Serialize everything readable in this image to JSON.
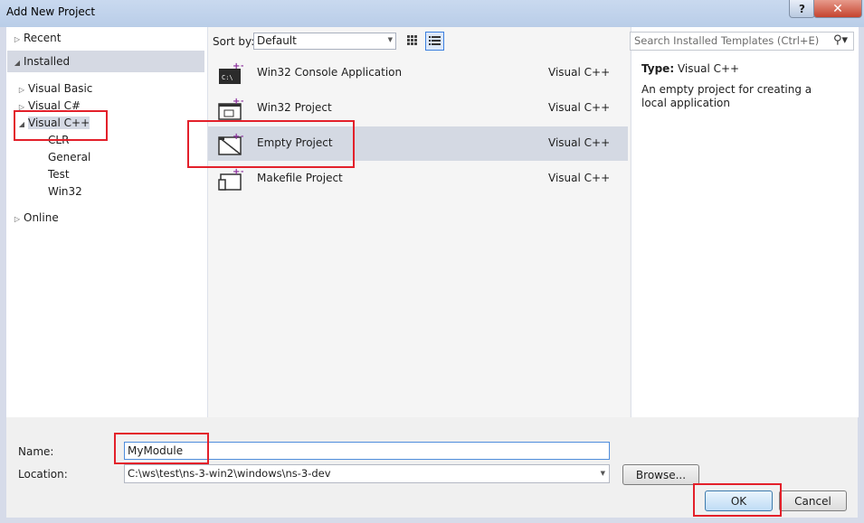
{
  "window": {
    "title": "Add New Project",
    "help_label": "?",
    "close_label": "✕"
  },
  "left_nav": {
    "recent": "Recent",
    "installed": "Installed",
    "visual_basic": "Visual Basic",
    "visual_csharp": "Visual C#",
    "visual_cpp": "Visual C++",
    "sub_items": [
      "CLR",
      "General",
      "Test",
      "Win32"
    ],
    "online": "Online"
  },
  "toolbar": {
    "sort_label": "Sort by:",
    "sort_value": "Default"
  },
  "search": {
    "placeholder": "Search Installed Templates (Ctrl+E)"
  },
  "templates": [
    {
      "name": "Win32 Console Application",
      "language": "Visual C++"
    },
    {
      "name": "Win32 Project",
      "language": "Visual C++"
    },
    {
      "name": "Empty Project",
      "language": "Visual C++",
      "selected": true
    },
    {
      "name": "Makefile Project",
      "language": "Visual C++"
    }
  ],
  "details": {
    "type_label": "Type:",
    "type_value": "Visual C++",
    "description": "An empty project for creating a local application"
  },
  "form": {
    "name_label": "Name:",
    "name_value": "MyModule",
    "location_label": "Location:",
    "location_value": "C:\\ws\\test\\ns-3-win2\\windows\\ns-3-dev",
    "browse_label": "Browse...",
    "ok_label": "OK",
    "cancel_label": "Cancel"
  },
  "colors": {
    "highlight": "#e3202a",
    "selection": "#d4d9e3",
    "accent": "#3d80df"
  }
}
